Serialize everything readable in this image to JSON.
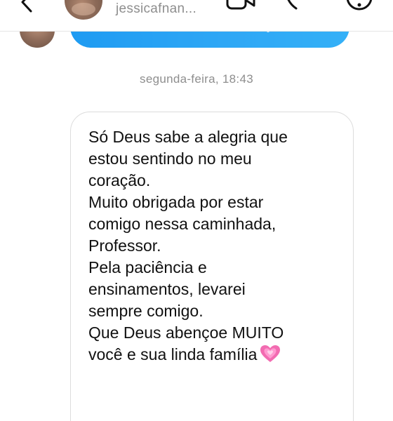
{
  "header": {
    "username": "jessicafnan...",
    "back_icon": "chevron-left-icon",
    "video_icon": "video-camera-icon",
    "phone_icon": "phone-icon",
    "info_icon": "info-icon"
  },
  "thread": {
    "timestamp": "segunda-feira, 18:43",
    "message_lines": [
      "Só Deus sabe a alegria que",
      "estou sentindo no meu",
      "coração.",
      "Muito obrigada por estar",
      "comigo nessa caminhada,",
      "Professor.",
      "Pela paciência e",
      "ensinamentos, levarei",
      "sempre comigo.",
      "Que Deus abençoe MUITO",
      "você e sua linda família"
    ],
    "message_emoji": "growing-heart-icon"
  },
  "colors": {
    "outgoing_bubble": "#2ea7f5",
    "incoming_border": "#dcdcdc",
    "meta_text": "#8e8e8e",
    "heart": "#f26bb1"
  }
}
